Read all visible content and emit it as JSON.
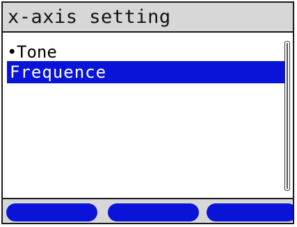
{
  "title": "x-axis setting",
  "list": {
    "items": [
      {
        "marker": "•",
        "label": "Tone",
        "selected": false
      },
      {
        "marker": "",
        "label": "Frequence",
        "selected": true
      }
    ]
  },
  "softkeys": [
    {
      "label": ""
    },
    {
      "label": ""
    },
    {
      "label": ""
    }
  ],
  "colors": {
    "highlight": "#0a14d8",
    "title_bar": "#d7d7d7",
    "softkey": "#0a14d8"
  }
}
